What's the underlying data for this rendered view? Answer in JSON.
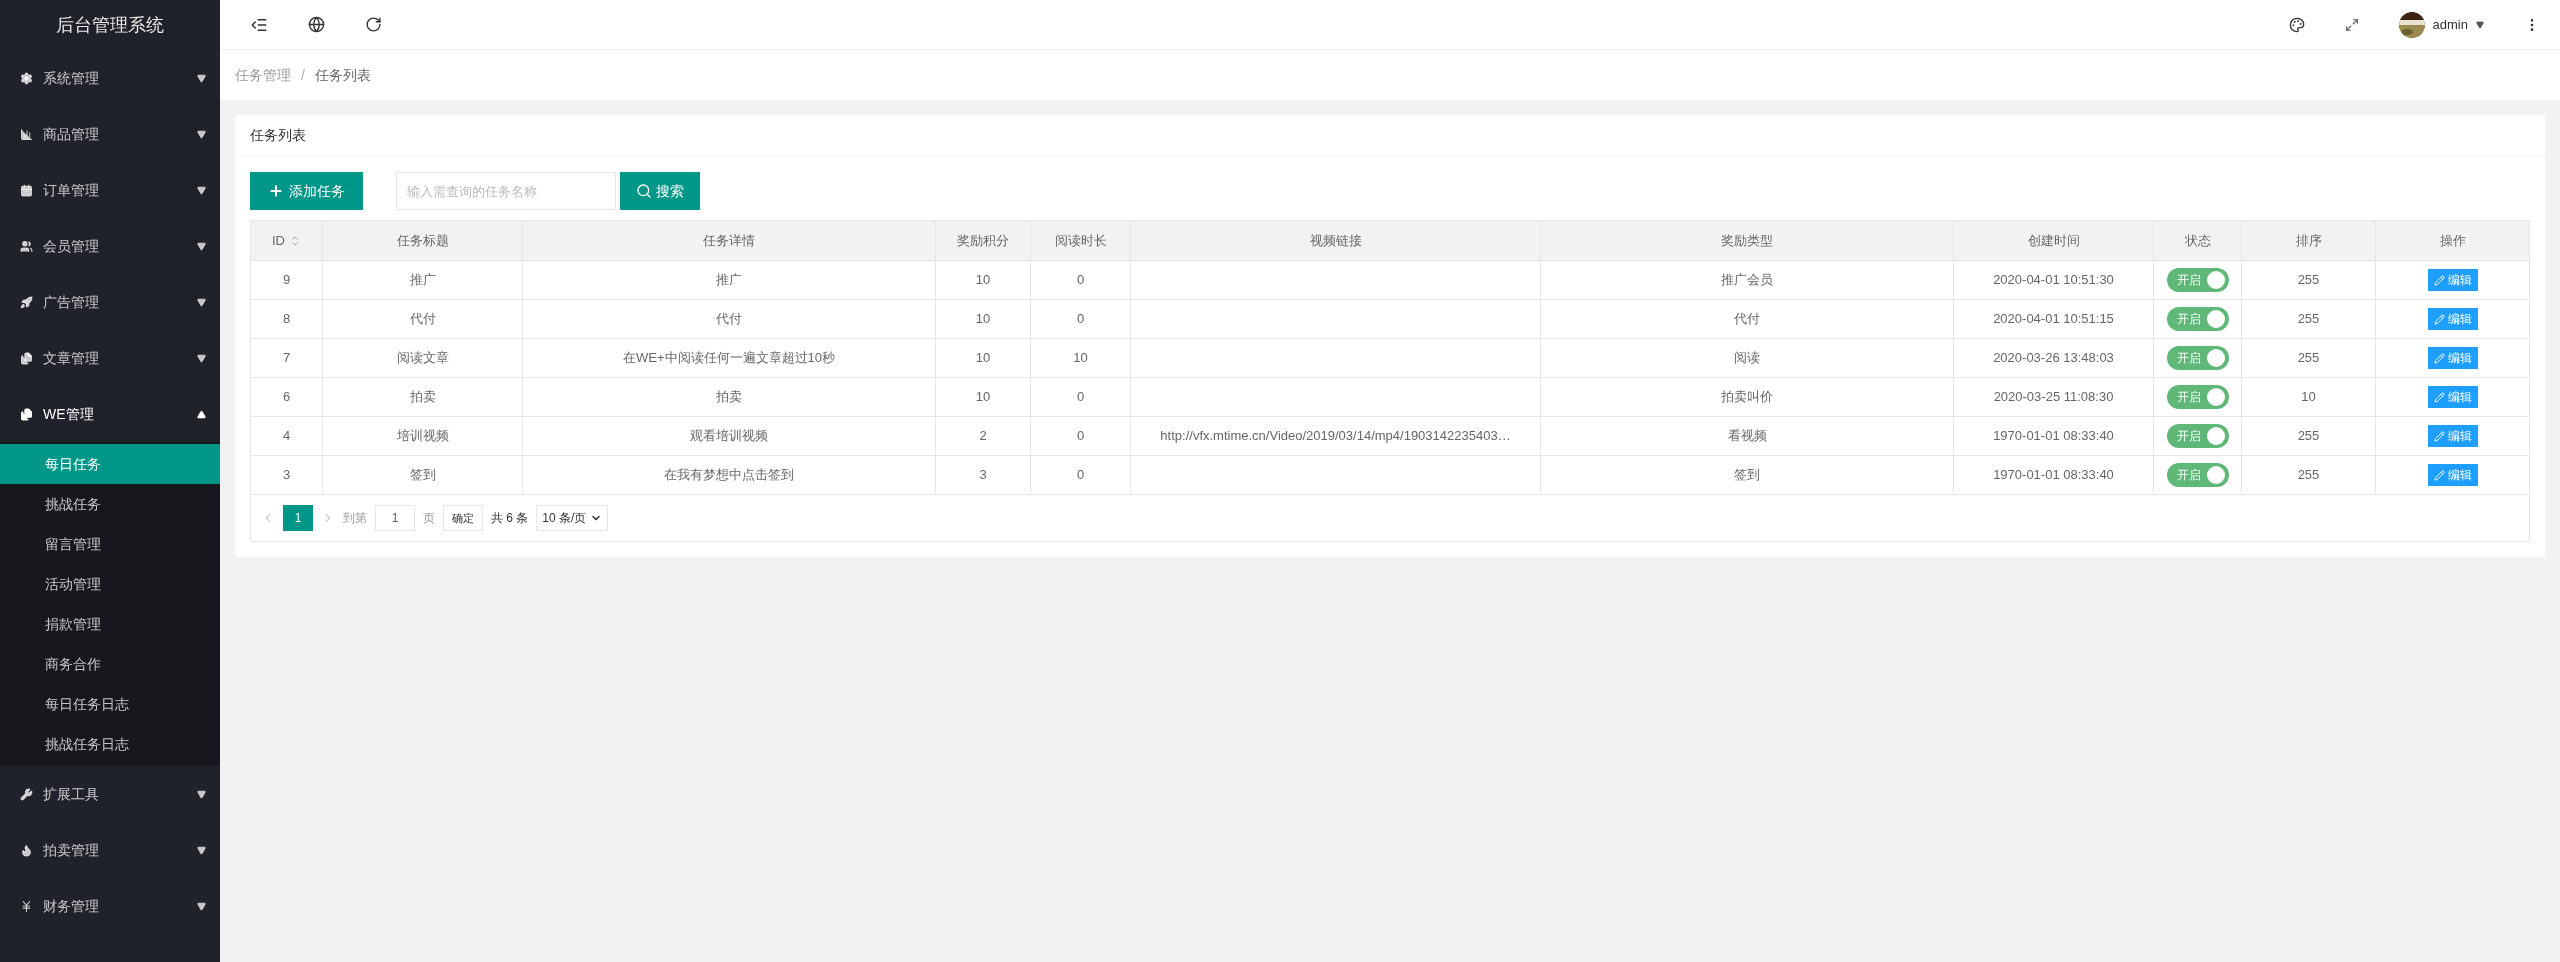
{
  "sidebar": {
    "title": "后台管理系统",
    "items": [
      {
        "label": "系统管理",
        "expanded": false
      },
      {
        "label": "商品管理",
        "expanded": false
      },
      {
        "label": "订单管理",
        "expanded": false
      },
      {
        "label": "会员管理",
        "expanded": false
      },
      {
        "label": "广告管理",
        "expanded": false
      },
      {
        "label": "文章管理",
        "expanded": false
      },
      {
        "label": "WE管理",
        "expanded": true,
        "children": [
          {
            "label": "每日任务",
            "selected": true
          },
          {
            "label": "挑战任务",
            "selected": false
          },
          {
            "label": "留言管理",
            "selected": false
          },
          {
            "label": "活动管理",
            "selected": false
          },
          {
            "label": "捐款管理",
            "selected": false
          },
          {
            "label": "商务合作",
            "selected": false
          },
          {
            "label": "每日任务日志",
            "selected": false
          },
          {
            "label": "挑战任务日志",
            "selected": false
          }
        ]
      },
      {
        "label": "扩展工具",
        "expanded": false
      },
      {
        "label": "拍卖管理",
        "expanded": false
      },
      {
        "label": "财务管理",
        "expanded": false
      }
    ]
  },
  "header": {
    "user": "admin"
  },
  "breadcrumb": {
    "items": [
      "任务管理",
      "任务列表"
    ],
    "separator": "/"
  },
  "card": {
    "title": "任务列表",
    "add_button": "添加任务",
    "search": {
      "placeholder": "输入需查询的任务名称"
    },
    "search_button": "搜索"
  },
  "table": {
    "columns": [
      "ID",
      "任务标题",
      "任务详情",
      "奖励积分",
      "阅读时长",
      "视频链接",
      "奖励类型",
      "创建时间",
      "状态",
      "排序",
      "操作"
    ],
    "rows": [
      {
        "id": "9",
        "title": "推广",
        "detail": "推广",
        "points": "10",
        "read_time": "0",
        "reward_type": "推广会员",
        "created": "2020-04-01 10:51:30",
        "status": {
          "label": "开启",
          "on": true
        },
        "sort": "255",
        "action": "编辑"
      },
      {
        "id": "8",
        "title": "代付",
        "detail": "代付",
        "points": "10",
        "read_time": "0",
        "reward_type": "代付",
        "created": "2020-04-01 10:51:15",
        "status": {
          "label": "开启",
          "on": true
        },
        "sort": "255",
        "action": "编辑"
      },
      {
        "id": "7",
        "title": "阅读文章",
        "detail": "在WE+中阅读任何一遍文章超过10秒",
        "points": "10",
        "read_time": "10",
        "reward_type": "阅读",
        "created": "2020-03-26 13:48:03",
        "status": {
          "label": "开启",
          "on": true
        },
        "sort": "255",
        "action": "编辑"
      },
      {
        "id": "6",
        "title": "拍卖",
        "detail": "拍卖",
        "points": "10",
        "read_time": "0",
        "reward_type": "拍卖叫价",
        "created": "2020-03-25 11:08:30",
        "status": {
          "label": "开启",
          "on": true
        },
        "sort": "10",
        "action": "编辑"
      },
      {
        "id": "4",
        "title": "培训视频",
        "detail": "观看培训视频",
        "points": "2",
        "read_time": "0",
        "video": "http://vfx.mtime.cn/Video/2019/03/14/mp4/1903142235403…",
        "reward_type": "看视频",
        "created": "1970-01-01 08:33:40",
        "status": {
          "label": "开启",
          "on": true
        },
        "sort": "255",
        "action": "编辑"
      },
      {
        "id": "3",
        "title": "签到",
        "detail": "在我有梦想中点击签到",
        "points": "3",
        "read_time": "0",
        "reward_type": "签到",
        "created": "1970-01-01 08:33:40",
        "status": {
          "label": "开启",
          "on": true
        },
        "sort": "255",
        "action": "编辑"
      }
    ]
  },
  "pagination": {
    "pages": [
      {
        "label": "1",
        "selected": true
      }
    ],
    "goto_label": "到第",
    "goto_value": "1",
    "page_unit": "页",
    "confirm": "确定",
    "total": "共 6 条",
    "page_size": "10 条/页"
  }
}
